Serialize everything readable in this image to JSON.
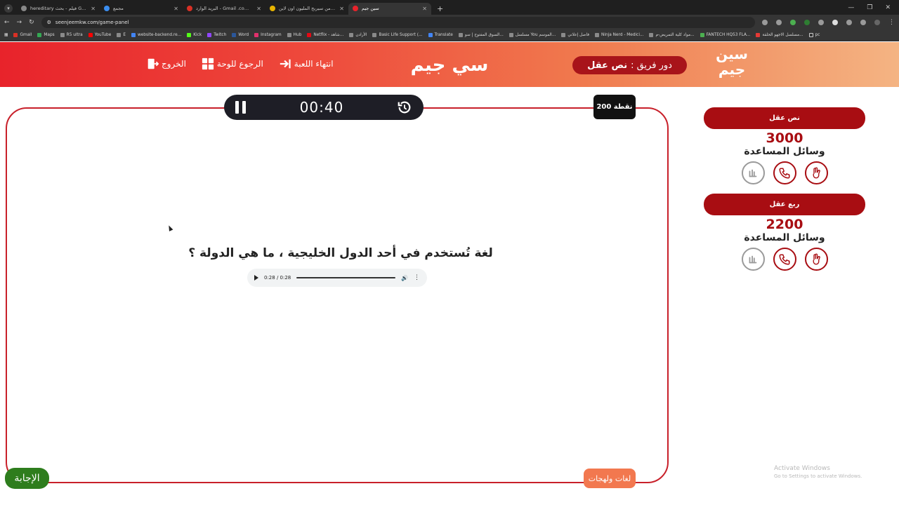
{
  "browser": {
    "tabs": [
      {
        "title": "hereditary فيلم - بحث Google",
        "active": false
      },
      {
        "title": "مجمع",
        "active": false
      },
      {
        "title": "البريد الوارد - Gmail .com@gmail",
        "active": false
      },
      {
        "title": "لعبة من سيربح المليون اون لاين -",
        "active": false
      },
      {
        "title": "سين جيم",
        "active": true
      }
    ],
    "url": "seenjeemkw.com/game-panel",
    "bookmarks": [
      "Gmail",
      "Maps",
      "R5 ultra",
      "YouTube",
      "E",
      "website-backend.re...",
      "Kick",
      "Twitch",
      "Word",
      "Instagram",
      "Hub",
      "Netflix - شاهد...",
      "الأرادن",
      "Basic Life Support (...",
      "Translate",
      "السوق المفتوح | سو...",
      "مسلسل You الموسم...",
      "فاصل إعلاني",
      "Ninja Nerd - Medici...",
      "مواد كلية التمريض-م...",
      "FANTECH HQ53 FLA...",
      "مسلسل الاجهو الحلقة...",
      "pc"
    ]
  },
  "header": {
    "logo_text": "سين جيم",
    "turn_prefix": "دور فريق :",
    "turn_team": "نص عقل",
    "title": "سي جيم",
    "end_game": "انتهاء اللعبة",
    "back_to_board": "الرجوع للوحة",
    "exit": "الخروج"
  },
  "game": {
    "timer": "00:40",
    "points": "200 نقطة",
    "question": "لغة تُستخدم في أحد الدول الخليجية ، ما هي الدولة ؟",
    "audio_time": "0:28 / 0:28",
    "category": "لغات ولهجات",
    "answer_button": "الإجابة"
  },
  "teams": [
    {
      "name": "نص عقل",
      "score": "3000",
      "aids_label": "وسائل المساعدة"
    },
    {
      "name": "ربع عقل",
      "score": "2200",
      "aids_label": "وسائل المساعدة"
    }
  ],
  "watermark": {
    "title": "Activate Windows",
    "subtitle": "Go to Settings to activate Windows."
  },
  "colors": {
    "brand_red": "#a80d12",
    "header_gradient_start": "#e8232b",
    "header_gradient_end": "#f4b483",
    "answer_green": "#2e7d1d",
    "category_orange": "#f2784f"
  }
}
